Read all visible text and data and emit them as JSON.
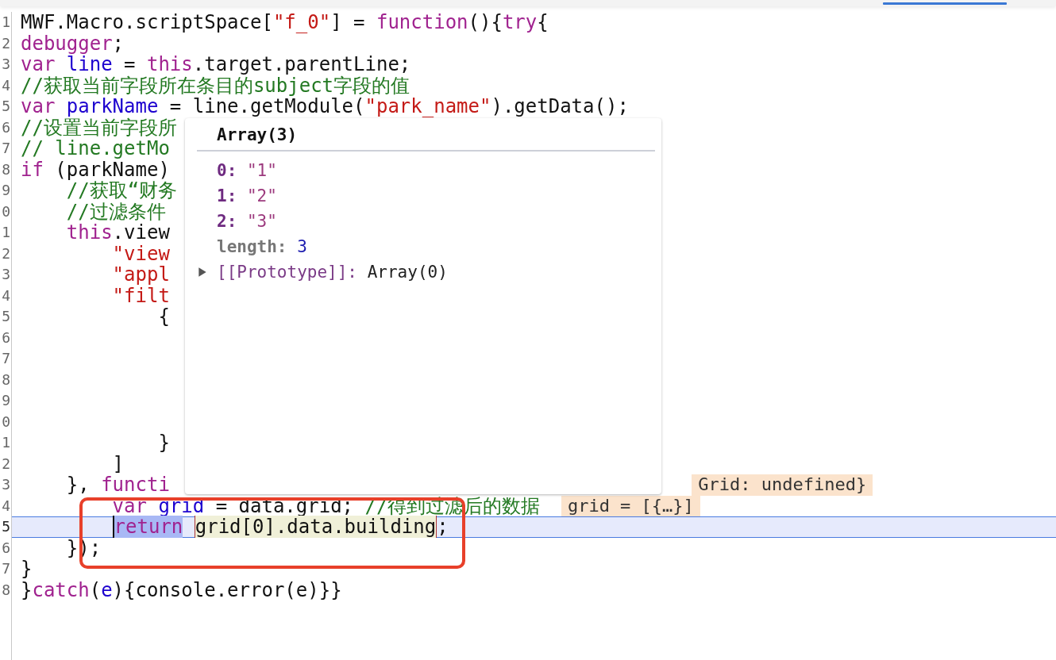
{
  "lines": [
    {
      "num": "1",
      "current": false,
      "tokens": [
        {
          "text": "MWF.Macro.scriptSpace[",
          "kind": "plain"
        },
        {
          "text": "\"f_0\"",
          "kind": "string"
        },
        {
          "text": "] = ",
          "kind": "plain"
        },
        {
          "text": "function",
          "kind": "keyword"
        },
        {
          "text": "(){",
          "kind": "plain"
        },
        {
          "text": "try",
          "kind": "keyword"
        },
        {
          "text": "{",
          "kind": "plain"
        }
      ]
    },
    {
      "num": "2",
      "current": false,
      "tokens": [
        {
          "text": "debugger",
          "kind": "keyword"
        },
        {
          "text": ";",
          "kind": "plain"
        }
      ]
    },
    {
      "num": "3",
      "current": false,
      "tokens": [
        {
          "text": "var",
          "kind": "keyword"
        },
        {
          "text": " line",
          "kind": "variable"
        },
        {
          "text": " = ",
          "kind": "plain"
        },
        {
          "text": "this",
          "kind": "keyword"
        },
        {
          "text": ".target.parentLine;",
          "kind": "plain"
        }
      ]
    },
    {
      "num": "4",
      "current": false,
      "tokens": [
        {
          "text": "//获取当前字段所在条目的subject字段的值",
          "kind": "comment"
        }
      ]
    },
    {
      "num": "5",
      "current": false,
      "tokens": [
        {
          "text": "var",
          "kind": "keyword"
        },
        {
          "text": " parkName",
          "kind": "variable"
        },
        {
          "text": " = line.getModule(",
          "kind": "plain"
        },
        {
          "text": "\"park_name\"",
          "kind": "string"
        },
        {
          "text": ").getData();",
          "kind": "plain"
        }
      ]
    },
    {
      "num": "6",
      "current": false,
      "tokens": [
        {
          "text": "//设置当前字段所",
          "kind": "comment"
        }
      ]
    },
    {
      "num": "7",
      "current": false,
      "tokens": [
        {
          "text": "// line.getMo",
          "kind": "comment"
        }
      ]
    },
    {
      "num": "8",
      "current": false,
      "tokens": [
        {
          "text": "if",
          "kind": "keyword"
        },
        {
          "text": " (parkName)",
          "kind": "plain"
        }
      ]
    },
    {
      "num": "9",
      "current": false,
      "tokens": [
        {
          "text": "    //获取“财务",
          "kind": "comment"
        }
      ]
    },
    {
      "num": "0",
      "current": false,
      "tokens": [
        {
          "text": "    //过滤条件",
          "kind": "comment"
        }
      ]
    },
    {
      "num": "1",
      "current": false,
      "tokens": [
        {
          "text": "    this",
          "kind": "keyword"
        },
        {
          "text": ".view",
          "kind": "plain"
        }
      ]
    },
    {
      "num": "2",
      "current": false,
      "tokens": [
        {
          "text": "        \"view",
          "kind": "string"
        }
      ]
    },
    {
      "num": "3",
      "current": false,
      "tokens": [
        {
          "text": "        \"appl",
          "kind": "string"
        }
      ]
    },
    {
      "num": "4",
      "current": false,
      "tokens": [
        {
          "text": "        \"filt",
          "kind": "string"
        }
      ]
    },
    {
      "num": "5",
      "current": false,
      "tokens": [
        {
          "text": "            {",
          "kind": "plain"
        }
      ]
    },
    {
      "num": "6",
      "current": false
    },
    {
      "num": "7",
      "current": false
    },
    {
      "num": "8",
      "current": false
    },
    {
      "num": "9",
      "current": false
    },
    {
      "num": "0",
      "current": false
    },
    {
      "num": "1",
      "current": false,
      "tokens": [
        {
          "text": "            }",
          "kind": "plain"
        }
      ]
    },
    {
      "num": "2",
      "current": false,
      "tokens": [
        {
          "text": "        ]",
          "kind": "plain"
        }
      ]
    },
    {
      "num": "3",
      "current": false,
      "tokens": [
        {
          "text": "    },",
          "kind": "plain"
        },
        {
          "text": " functi",
          "kind": "keyword"
        }
      ],
      "inline_value": "Grid: undefined}"
    },
    {
      "num": "4",
      "current": false,
      "tokens": [
        {
          "text": "        var",
          "kind": "keyword"
        },
        {
          "text": " grid",
          "kind": "variable"
        },
        {
          "text": " = data.grid; ",
          "kind": "plain"
        },
        {
          "text": "//得到过滤后的数据",
          "kind": "comment"
        }
      ],
      "inline_value": "grid = [{…}]"
    },
    {
      "num": "5",
      "current": true,
      "tokens": [
        {
          "text": "        return",
          "kind": "selected"
        },
        {
          "text": " grid[0].data.building",
          "kind": "evaluated"
        },
        {
          "text": ";",
          "kind": "plain"
        }
      ]
    },
    {
      "num": "6",
      "current": false,
      "tokens": [
        {
          "text": "    });",
          "kind": "plain"
        }
      ]
    },
    {
      "num": "7",
      "current": false,
      "tokens": [
        {
          "text": "}",
          "kind": "plain"
        }
      ]
    },
    {
      "num": "8",
      "current": false,
      "tokens": [
        {
          "text": "}",
          "kind": "plain"
        },
        {
          "text": "catch",
          "kind": "keyword"
        },
        {
          "text": "(",
          "kind": "plain"
        },
        {
          "text": "e",
          "kind": "variable"
        },
        {
          "text": "){console.error(e)}}",
          "kind": "plain"
        }
      ]
    }
  ],
  "popover": {
    "title": "Array(3)",
    "entries": [
      {
        "key": "0:",
        "value": "\"1\"",
        "kind": "string"
      },
      {
        "key": "1:",
        "value": "\"2\"",
        "kind": "string"
      },
      {
        "key": "2:",
        "value": "\"3\"",
        "kind": "string"
      },
      {
        "key": "length:",
        "value": "3",
        "kind": "number"
      },
      {
        "key": "[[Prototype]]:",
        "value": "Array(0)",
        "kind": "prototype",
        "expanded": false
      }
    ]
  }
}
